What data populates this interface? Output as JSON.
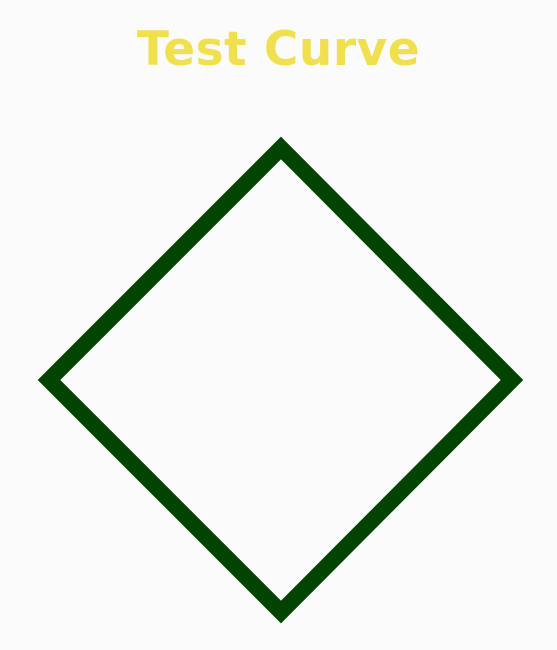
{
  "title": "Test Curve",
  "colors": {
    "title": "#f0e04f",
    "curve": "#004400",
    "background": "#fbfbfb"
  },
  "curve": {
    "shape": "diamond",
    "closed": true
  }
}
